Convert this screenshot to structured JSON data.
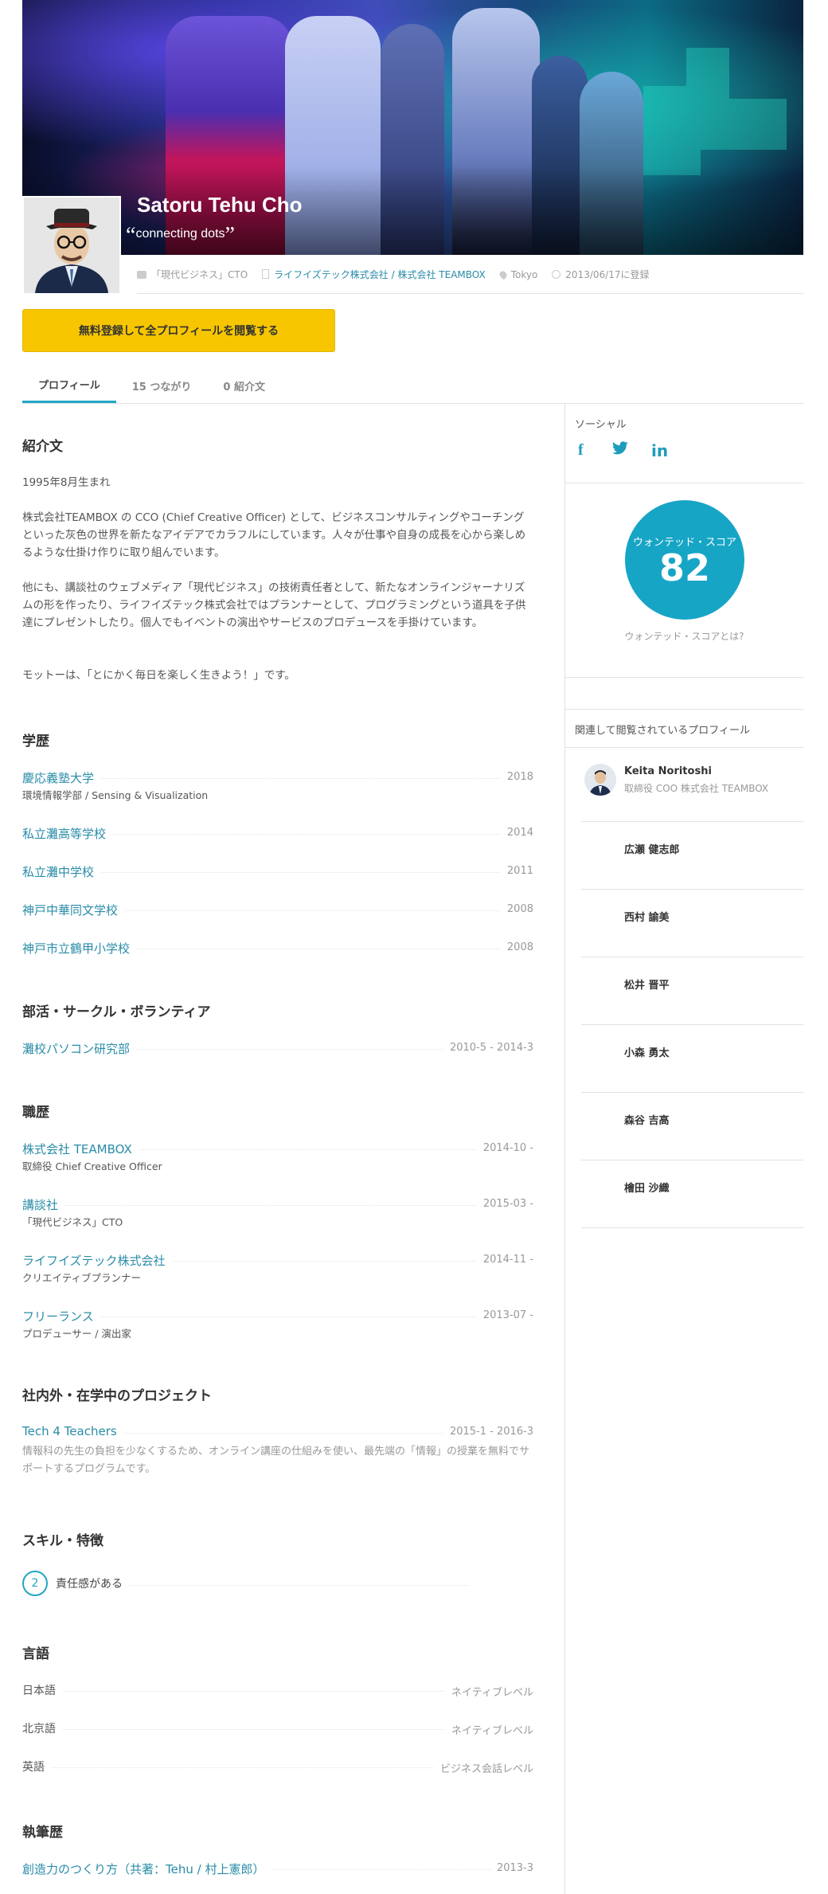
{
  "header": {
    "name": "Satoru Tehu Cho",
    "tagline": "connecting dots",
    "quote_open": "“",
    "quote_close": "”",
    "meta": {
      "position": "「現代ビジネス」CTO",
      "company": "ライフイズテック株式会社 / 株式会社 TEAMBOX",
      "location": "Tokyo",
      "registered": "2013/06/17に登録"
    },
    "cta_label": "無料登録して全プロフィールを閲覧する"
  },
  "tabs": [
    {
      "label": "プロフィール",
      "active": true
    },
    {
      "label": "15 つながり",
      "active": false
    },
    {
      "label": "0 紹介文",
      "active": false
    }
  ],
  "intro": {
    "heading": "紹介文",
    "paragraphs": [
      "1995年8月生まれ",
      "株式会社TEAMBOX の CCO (Chief Creative Officer) として、ビジネスコンサルティングやコーチングといった灰色の世界を新たなアイデアでカラフルにしています。人々が仕事や自身の成長を心から楽しめるような仕掛け作りに取り組んでいます。",
      "他にも、講談社のウェブメディア「現代ビジネス」の技術責任者として、新たなオンラインジャーナリズムの形を作ったり、ライフイズテック株式会社ではプランナーとして、プログラミングという道具を子供達にプレゼントしたり。個人でもイベントの演出やサービスのプロデュースを手掛けています。",
      "モットーは、「とにかく毎日を楽しく生きよう！」です。"
    ]
  },
  "education": {
    "heading": "学歴",
    "items": [
      {
        "name": "慶応義塾大学",
        "sub": "環境情報学部 / Sensing & Visualization",
        "year": "2018"
      },
      {
        "name": "私立灘高等学校",
        "sub": "",
        "year": "2014"
      },
      {
        "name": "私立灘中学校",
        "sub": "",
        "year": "2011"
      },
      {
        "name": "神戸中華同文学校",
        "sub": "",
        "year": "2008"
      },
      {
        "name": "神戸市立鶴甲小学校",
        "sub": "",
        "year": "2008"
      }
    ]
  },
  "clubs": {
    "heading": "部活・サークル・ボランティア",
    "items": [
      {
        "name": "灘校パソコン研究部",
        "year": "2010-5 - 2014-3"
      }
    ]
  },
  "career": {
    "heading": "職歴",
    "items": [
      {
        "name": "株式会社 TEAMBOX",
        "sub": "取締役 Chief Creative Officer",
        "year": "2014-10 -"
      },
      {
        "name": "講談社",
        "sub": "「現代ビジネス」CTO",
        "year": "2015-03 -"
      },
      {
        "name": "ライフイズテック株式会社",
        "sub": "クリエイティブプランナー",
        "year": "2014-11 -"
      },
      {
        "name": "フリーランス",
        "sub": "プロデューサー / 演出家",
        "year": "2013-07 -"
      }
    ]
  },
  "projects": {
    "heading": "社内外・在学中のプロジェクト",
    "items": [
      {
        "name": "Tech 4 Teachers",
        "year": "2015-1 - 2016-3",
        "desc": "情報科の先生の負担を少なくするため、オンライン講座の仕組みを使い、最先端の「情報」の授業を無料でサポートするプログラムです。"
      }
    ]
  },
  "skills": {
    "heading": "スキル・特徴",
    "items": [
      {
        "count": "2",
        "label": "責任感がある"
      }
    ]
  },
  "languages": {
    "heading": "言語",
    "items": [
      {
        "name": "日本語",
        "level": "ネイティブレベル"
      },
      {
        "name": "北京語",
        "level": "ネイティブレベル"
      },
      {
        "name": "英語",
        "level": "ビジネス会話レベル"
      }
    ]
  },
  "writing": {
    "heading": "執筆歴",
    "items": [
      {
        "name": "創造力のつくり方（共著：Tehu / 村上憲郎）",
        "year": "2013-3"
      }
    ]
  },
  "sidebar": {
    "social_label": "ソーシャル",
    "social": [
      {
        "icon": "facebook-icon",
        "glyph": "f"
      },
      {
        "icon": "twitter-icon",
        "glyph": "🐦"
      },
      {
        "icon": "linkedin-icon",
        "glyph": "in"
      }
    ],
    "score_label": "ウォンテッド・スコア",
    "score_value": "82",
    "score_link": "ウォンテッド・スコアとは?",
    "related_heading": "関連して閲覧されているプロフィール",
    "related": [
      {
        "name": "Keita Noritoshi",
        "sub": "取締役 COO 株式会社 TEAMBOX"
      },
      {
        "name": "広瀬 健志郎",
        "sub": ""
      },
      {
        "name": "西村 諭美",
        "sub": ""
      },
      {
        "name": "松井 晋平",
        "sub": ""
      },
      {
        "name": "小森 勇太",
        "sub": ""
      },
      {
        "name": "森谷 吉高",
        "sub": ""
      },
      {
        "name": "檜田 沙織",
        "sub": ""
      }
    ]
  },
  "colors": {
    "accent": "#22a6c4",
    "link": "#2a8ca8",
    "cta": "#f7c600"
  }
}
